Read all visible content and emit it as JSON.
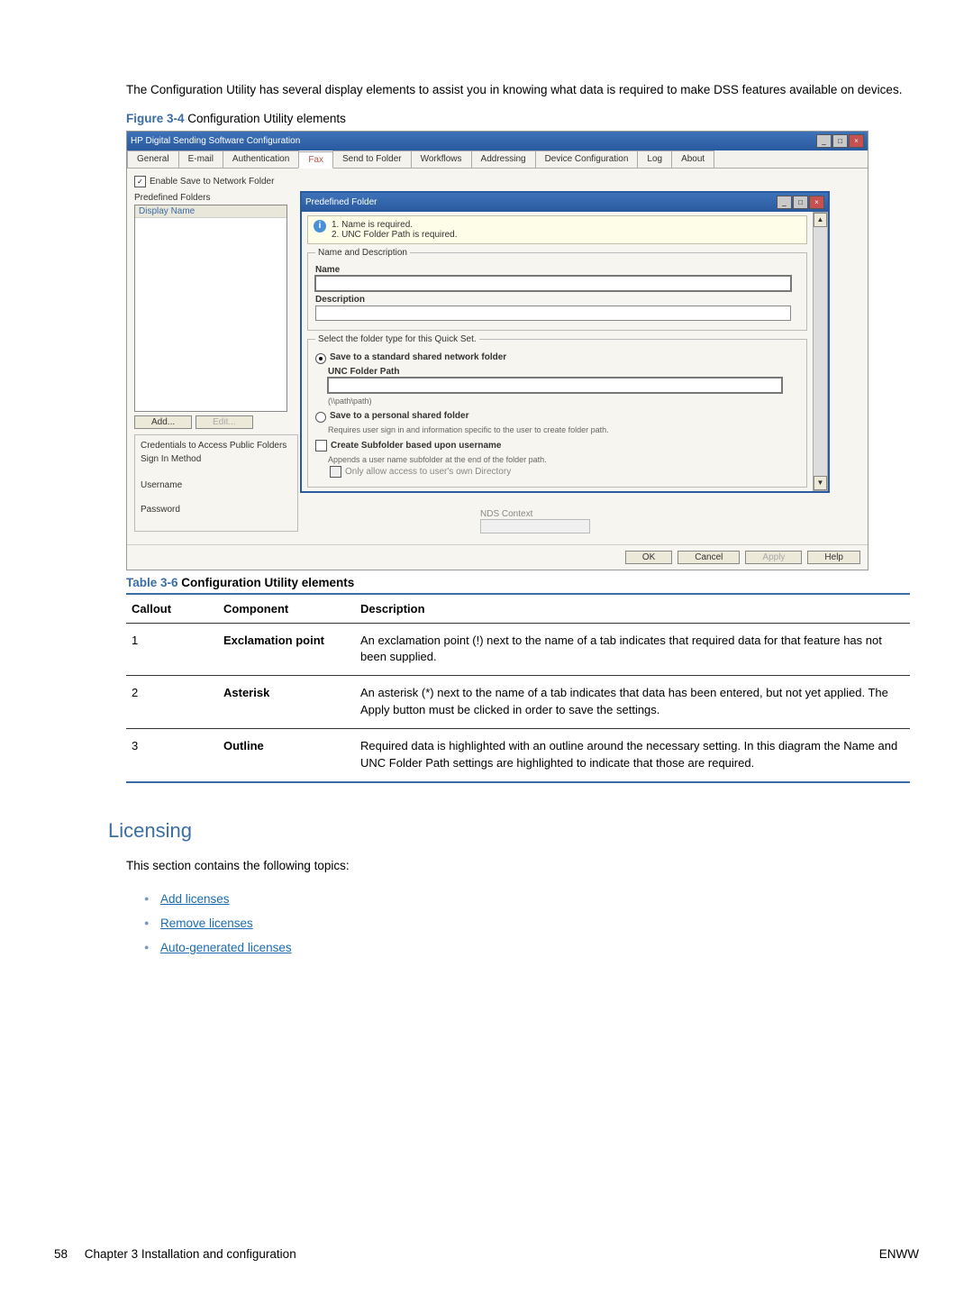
{
  "intro_text": "The Configuration Utility has several display elements to assist you in knowing what data is required to make DSS features available on devices.",
  "figure": {
    "number": "Figure 3-4",
    "title": " Configuration Utility elements"
  },
  "window": {
    "title": "HP Digital Sending Software Configuration",
    "tabs": [
      "General",
      "E-mail",
      "Authentication",
      "Fax",
      "Send to Folder",
      "Workflows",
      "Addressing",
      "Device Configuration",
      "Log",
      "About"
    ],
    "enable_checkbox": "Enable Save to Network Folder",
    "predefined_label": "Predefined Folders",
    "display_name_header": "Display Name",
    "add_btn": "Add...",
    "edit_btn": "Edit...",
    "cred_title": "Credentials to Access Public Folders",
    "signin_label": "Sign In Method",
    "username_label": "Username",
    "password_label": "Password",
    "nds_label": "NDS Context",
    "buttons": {
      "ok": "OK",
      "cancel": "Cancel",
      "apply": "Apply",
      "help": "Help"
    }
  },
  "dialog": {
    "title": "Predefined Folder",
    "info_lines": [
      "1.  Name is required.",
      "2.  UNC Folder Path is required."
    ],
    "nd_legend": "Name and Description",
    "name_label": "Name",
    "desc_label": "Description",
    "ft_legend": "Select the folder type for this Quick Set.",
    "opt1": "Save to a standard shared network folder",
    "unc_label": "UNC Folder Path",
    "unc_hint": "(\\\\path\\path)",
    "opt2": "Save to a personal shared folder",
    "opt2_hint": "Requires user sign in and information specific to the user to create folder path.",
    "create_sub": "Create Subfolder based upon username",
    "create_sub_hint": "Appends a user name subfolder at the end of the folder path.",
    "only_allow": "Only allow access to user's own Directory"
  },
  "table": {
    "number": "Table 3-6",
    "title": " Configuration Utility elements",
    "headers": [
      "Callout",
      "Component",
      "Description"
    ],
    "rows": [
      {
        "callout": "1",
        "component": "Exclamation point",
        "desc": "An exclamation point (!) next to the name of a tab indicates that required data for that feature has not been supplied."
      },
      {
        "callout": "2",
        "component": "Asterisk",
        "desc": "An asterisk (*) next to the name of a tab indicates that data has been entered, but not yet applied. The Apply button must be clicked in order to save the settings."
      },
      {
        "callout": "3",
        "component": "Outline",
        "desc": "Required data is highlighted with an outline around the necessary setting. In this diagram the Name and UNC Folder Path settings are highlighted to indicate that those are required."
      }
    ]
  },
  "section_heading": "Licensing",
  "topics_intro": "This section contains the following topics:",
  "links": [
    "Add licenses",
    "Remove licenses",
    "Auto-generated licenses"
  ],
  "footer": {
    "page": "58",
    "chapter": "Chapter 3   Installation and configuration",
    "brand": "ENWW"
  }
}
